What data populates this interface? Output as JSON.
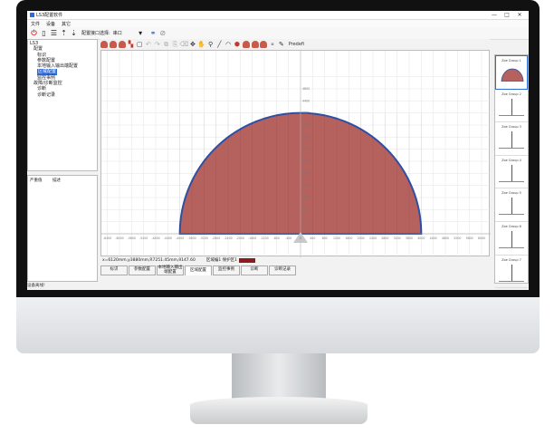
{
  "window": {
    "title": "LS3配置软件",
    "minimize": "—",
    "maximize": "□",
    "close": "✕"
  },
  "menu": [
    "文件",
    "设备",
    "其它"
  ],
  "toolbar": {
    "port_label": "配置接口选择:",
    "port_value": "串口"
  },
  "tree": [
    {
      "label": "LS3",
      "depth": 0,
      "selected": false
    },
    {
      "label": "配置",
      "depth": 1,
      "selected": false
    },
    {
      "label": "标识",
      "depth": 2,
      "selected": false
    },
    {
      "label": "参数配置",
      "depth": 2,
      "selected": false
    },
    {
      "label": "本地输入输出端配置",
      "depth": 2,
      "selected": false
    },
    {
      "label": "区域配置",
      "depth": 2,
      "selected": true
    },
    {
      "label": "监控事例",
      "depth": 2,
      "selected": false
    },
    {
      "label": "故障/诊断监控",
      "depth": 1,
      "selected": false
    },
    {
      "label": "诊断",
      "depth": 2,
      "selected": false
    },
    {
      "label": "诊断记录",
      "depth": 2,
      "selected": false
    }
  ],
  "log": {
    "col1": "严重值",
    "col2": "描述"
  },
  "status_left": "设备离线!",
  "predefined_label": "Predefi",
  "plot": {
    "x_ticks": [
      "-6400",
      "-6000",
      "-5600",
      "-5200",
      "-4800",
      "-4400",
      "-4000",
      "-3600",
      "-3200",
      "-2800",
      "-2400",
      "-2000",
      "-1600",
      "-1200",
      "-800",
      "-400",
      "0",
      "400",
      "800",
      "1200",
      "1600",
      "2000",
      "2400",
      "2800",
      "3200",
      "3600",
      "4000",
      "4400",
      "4800",
      "5200",
      "5600",
      "6000"
    ],
    "y_ticks": [
      "4800",
      "4400",
      "4000",
      "3600",
      "3200",
      "2800",
      "2400",
      "2000",
      "1600",
      "1200",
      "800",
      "400"
    ],
    "field_color": "#b5615e",
    "outline_color": "#2e4fa3",
    "radius": 4000
  },
  "coord_bar": {
    "text": "x=6120mm,y3880mm,R7251.45mm,θ147.60",
    "area_label": "区域编1 保护区1"
  },
  "tabs": [
    "标识",
    "参数配置",
    "本地输入输出端配置",
    "区域配置",
    "监控事例",
    "诊断",
    "诊断记录"
  ],
  "active_tab": 3,
  "zones": [
    "Zoe Group 1",
    "Zoe Group 2",
    "Zoe Group 3",
    "Zoe Group 4",
    "Zoe Group 5",
    "Zoe Group 6",
    "Zoe Group 7"
  ]
}
